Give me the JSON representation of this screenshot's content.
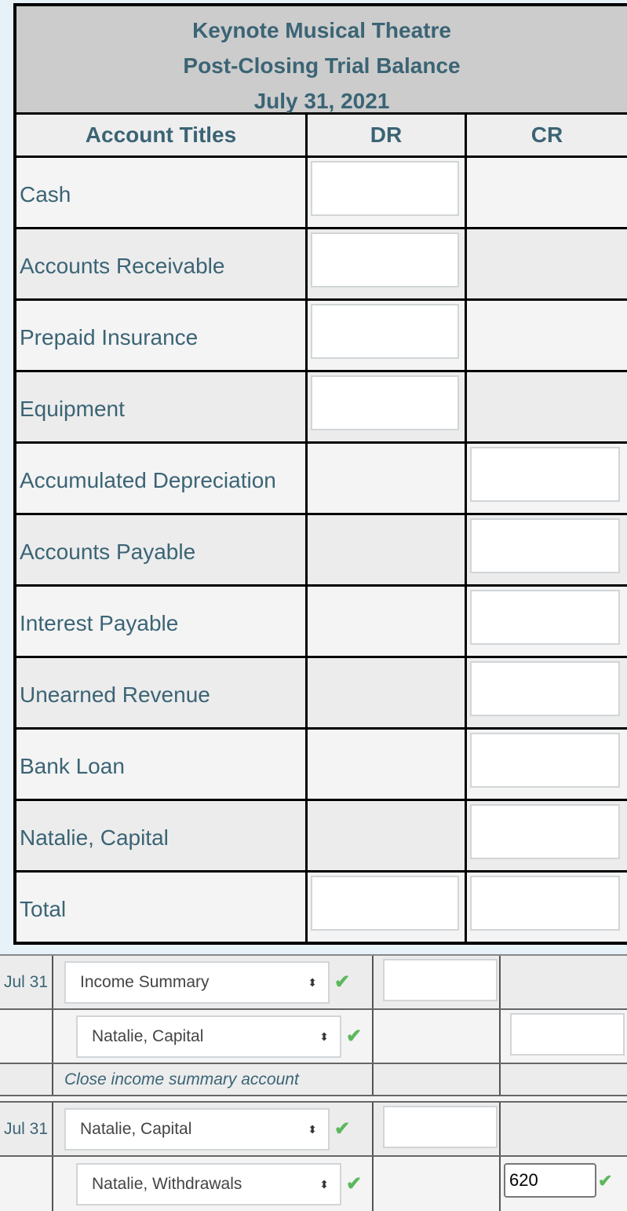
{
  "header": {
    "company": "Keynote Musical Theatre",
    "statement": "Post-Closing Trial Balance",
    "date": "July 31, 2021"
  },
  "columns": {
    "account": "Account Titles",
    "dr": "DR",
    "cr": "CR"
  },
  "accounts": [
    {
      "title": "Cash",
      "side": "dr",
      "dr": "",
      "cr": ""
    },
    {
      "title": "Accounts Receivable",
      "side": "dr",
      "dr": "",
      "cr": ""
    },
    {
      "title": "Prepaid Insurance",
      "side": "dr",
      "dr": "",
      "cr": ""
    },
    {
      "title": "Equipment",
      "side": "dr",
      "dr": "",
      "cr": ""
    },
    {
      "title": "Accumulated Depreciation",
      "side": "cr",
      "dr": "",
      "cr": ""
    },
    {
      "title": "Accounts Payable",
      "side": "cr",
      "dr": "",
      "cr": ""
    },
    {
      "title": "Interest Payable",
      "side": "cr",
      "dr": "",
      "cr": ""
    },
    {
      "title": "Unearned Revenue",
      "side": "cr",
      "dr": "",
      "cr": ""
    },
    {
      "title": "Bank Loan",
      "side": "cr",
      "dr": "",
      "cr": ""
    },
    {
      "title": "Natalie, Capital",
      "side": "cr",
      "dr": "",
      "cr": ""
    }
  ],
  "total": {
    "title": "Total",
    "dr": "",
    "cr": ""
  },
  "journal": {
    "entry1": {
      "date": "Jul 31",
      "debit_account": "Income Summary",
      "credit_account": "Natalie, Capital",
      "memo": "Close income summary account"
    },
    "entry2": {
      "date": "Jul 31",
      "debit_account": "Natalie, Capital",
      "credit_account": "Natalie, Withdrawals",
      "credit_amount": "620"
    }
  },
  "icons": {
    "check": "✔",
    "select_arrows": "⬍"
  }
}
